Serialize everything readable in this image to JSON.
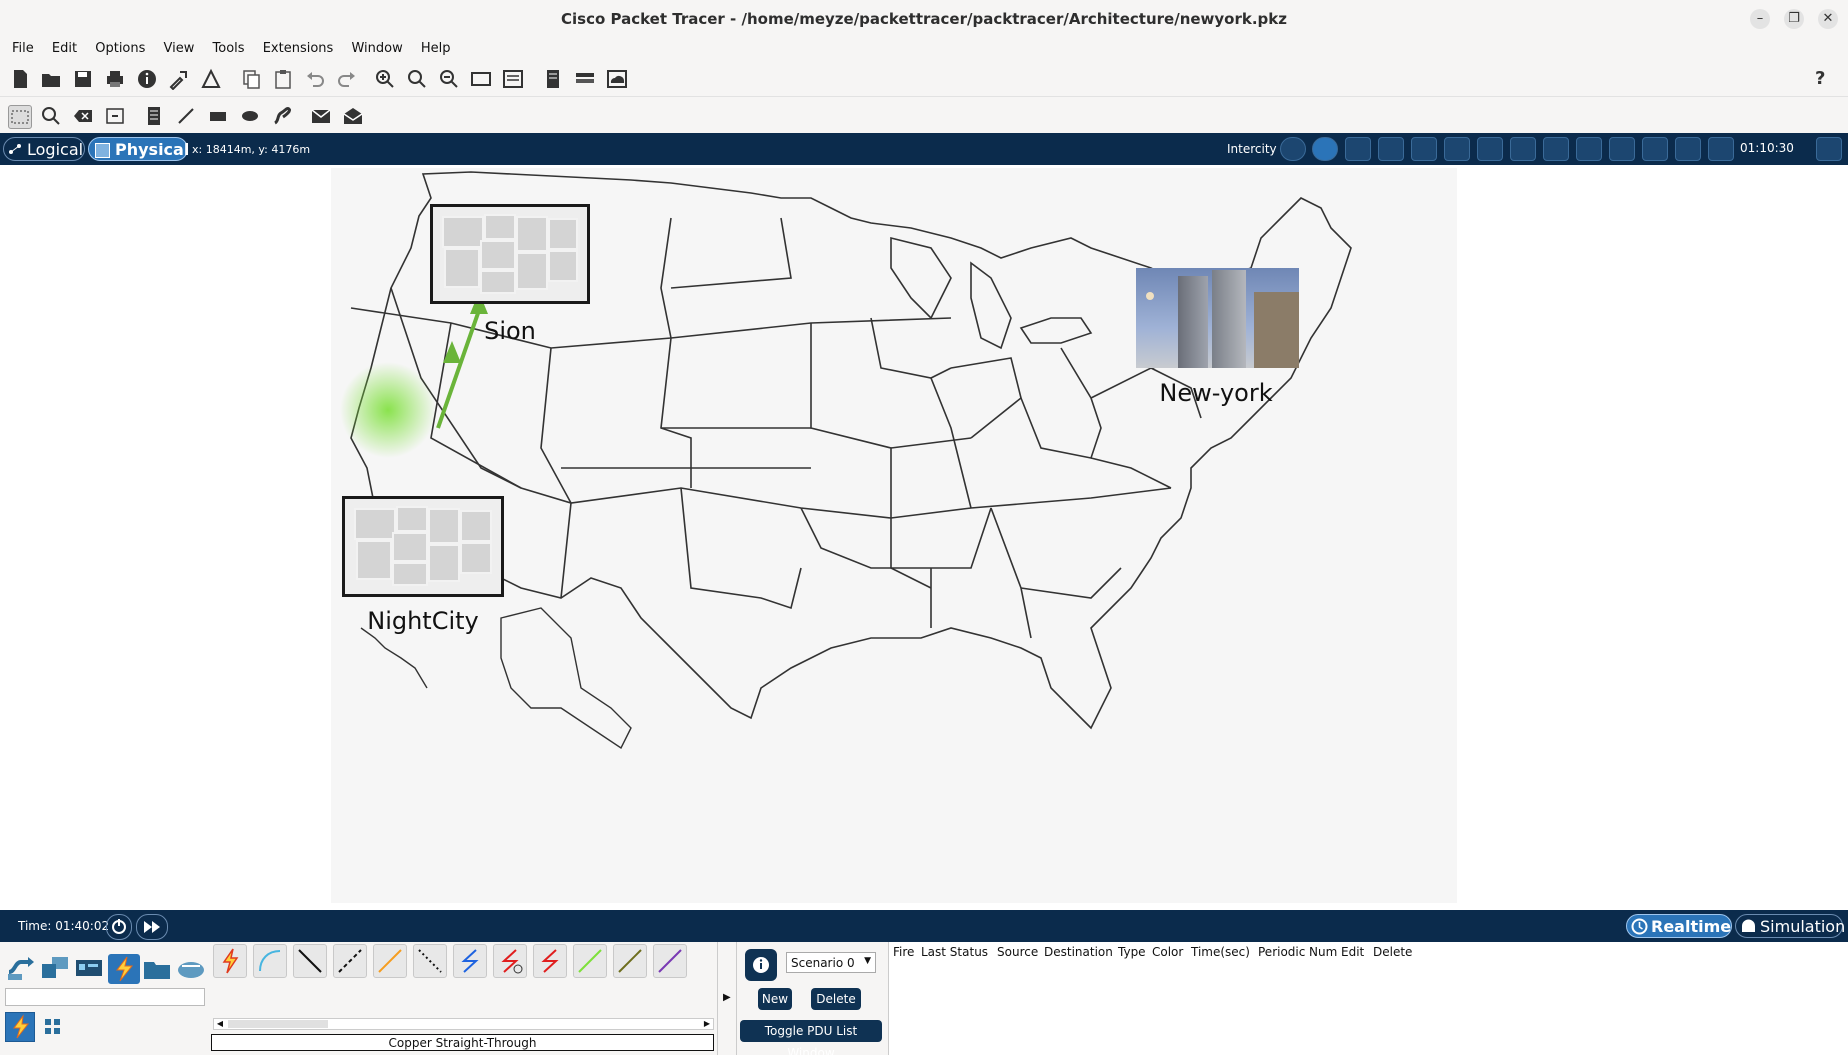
{
  "window": {
    "title": "Cisco Packet Tracer - /home/meyze/packettracer/packtracer/Architecture/newyork.pkz",
    "controls": [
      "minimize-icon",
      "restore-icon",
      "close-icon"
    ]
  },
  "menu": [
    "File",
    "Edit",
    "Options",
    "View",
    "Tools",
    "Extensions",
    "Window",
    "Help"
  ],
  "toolbar_icons": [
    "new-file-icon",
    "open-icon",
    "save-icon",
    "print-icon",
    "info-icon",
    "wizard-icon",
    "network-info-icon",
    "copy-icon",
    "paste-icon",
    "undo-icon",
    "redo-icon",
    "zoom-in-icon",
    "zoom-reset-icon",
    "zoom-out-icon",
    "drawing-palette-icon",
    "custom-device-icon",
    "notes-icon",
    "viewport-icon",
    "cloud-icon",
    "help-icon"
  ],
  "tools_icons": [
    "select-icon",
    "inspect-icon",
    "delete-icon",
    "resize-icon",
    "note-icon",
    "line-icon",
    "rectangle-icon",
    "ellipse-icon",
    "freeform-icon",
    "simple-pdu-icon",
    "complex-pdu-icon"
  ],
  "viewbar": {
    "logical_label": "Logical",
    "physical_label": "Physical",
    "coords": "x: 18414m, y: 4176m",
    "location": "Intercity",
    "clock": "01:10:30"
  },
  "map": {
    "sites": [
      {
        "name": "Sion"
      },
      {
        "name": "NightCity"
      },
      {
        "name": "New-york"
      }
    ]
  },
  "status": {
    "time": "Time: 01:40:02",
    "realtime_label": "Realtime",
    "simulation_label": "Simulation"
  },
  "connections": {
    "selected_label": "Copper Straight-Through",
    "search_value": ""
  },
  "pdu": {
    "scenario": "Scenario 0",
    "new_label": "New",
    "delete_label": "Delete",
    "toggle_label": "Toggle PDU List Window",
    "columns": [
      "Fire",
      "Last Status",
      "Source",
      "Destination",
      "Type",
      "Color",
      "Time(sec)",
      "Periodic",
      "Num",
      "Edit",
      "Delete"
    ]
  },
  "colors": {
    "link": "#6ab43a",
    "dark_bar": "#0b2b4c"
  }
}
